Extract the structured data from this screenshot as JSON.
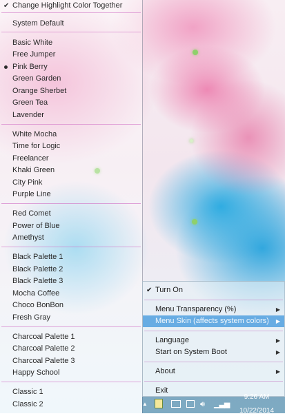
{
  "skin_menu": {
    "items": [
      {
        "label": "Change Highlight Color Together",
        "checked": true
      },
      {
        "label": "System Default"
      },
      {
        "label": "Basic White"
      },
      {
        "label": "Free Jumper"
      },
      {
        "label": "Pink Berry",
        "selected": true
      },
      {
        "label": "Green Garden"
      },
      {
        "label": "Orange Sherbet"
      },
      {
        "label": "Green Tea"
      },
      {
        "label": "Lavender"
      },
      {
        "label": "White Mocha"
      },
      {
        "label": "Time for Logic"
      },
      {
        "label": "Freelancer"
      },
      {
        "label": "Khaki Green"
      },
      {
        "label": "City Pink"
      },
      {
        "label": "Purple Line"
      },
      {
        "label": "Red Comet"
      },
      {
        "label": "Power of Blue"
      },
      {
        "label": "Amethyst"
      },
      {
        "label": "Black Palette 1"
      },
      {
        "label": "Black Palette 2"
      },
      {
        "label": "Black Palette 3"
      },
      {
        "label": "Mocha Coffee"
      },
      {
        "label": "Choco BonBon"
      },
      {
        "label": "Fresh Gray"
      },
      {
        "label": "Charcoal Palette 1"
      },
      {
        "label": "Charcoal Palette 2"
      },
      {
        "label": "Charcoal Palette 3"
      },
      {
        "label": "Happy School"
      },
      {
        "label": "Classic 1"
      },
      {
        "label": "Classic 2"
      }
    ]
  },
  "tray_menu": {
    "turn_on": "Turn On",
    "menu_transparency": "Menu Transparency (%)",
    "menu_skin": "Menu Skin (affects system colors)",
    "language": "Language",
    "start_on_boot": "Start on System Boot",
    "about": "About",
    "exit": "Exit"
  },
  "taskbar": {
    "time": "9:26 AM",
    "date": "10/22/2014"
  },
  "icons": {
    "check": "✔",
    "arrow": "▶",
    "up_arrow": "▲"
  }
}
